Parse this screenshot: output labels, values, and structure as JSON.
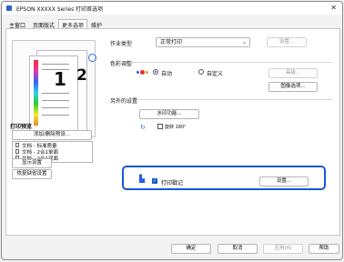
{
  "window": {
    "title": "EPSON  XXXXX  Series 打印首选项"
  },
  "tabs": [
    "主窗口",
    "页面版式",
    "更多选项",
    "维护"
  ],
  "left": {
    "preview_page_numbers": [
      "1",
      "2"
    ],
    "print_preview_label": "打印预览",
    "add_remove_presets": "添加/删除预设...",
    "presets": [
      "文档 - 标准质量",
      "文档 - 2合1单面",
      "文档 - 2合1双面"
    ],
    "show_settings": "显示设置",
    "restore_defaults": "恢复缺省设置"
  },
  "job_type": {
    "label": "作业类型",
    "value": "正常打印",
    "settings_button": "设置..."
  },
  "color_correction": {
    "label": "色彩调整",
    "auto_label": "自动",
    "custom_label": "自定义",
    "advanced_button": "高级...",
    "image_options_button": "图像选项..."
  },
  "extra": {
    "label": "另外的设置",
    "watermark_button": "水印功能...",
    "rotate_label": "旋转 180°"
  },
  "print_stamp": {
    "label": "打印戳记",
    "settings_button": "设置..."
  },
  "footer": {
    "ok": "确定",
    "cancel": "取消",
    "apply": "应用(A)",
    "help": "帮助"
  }
}
